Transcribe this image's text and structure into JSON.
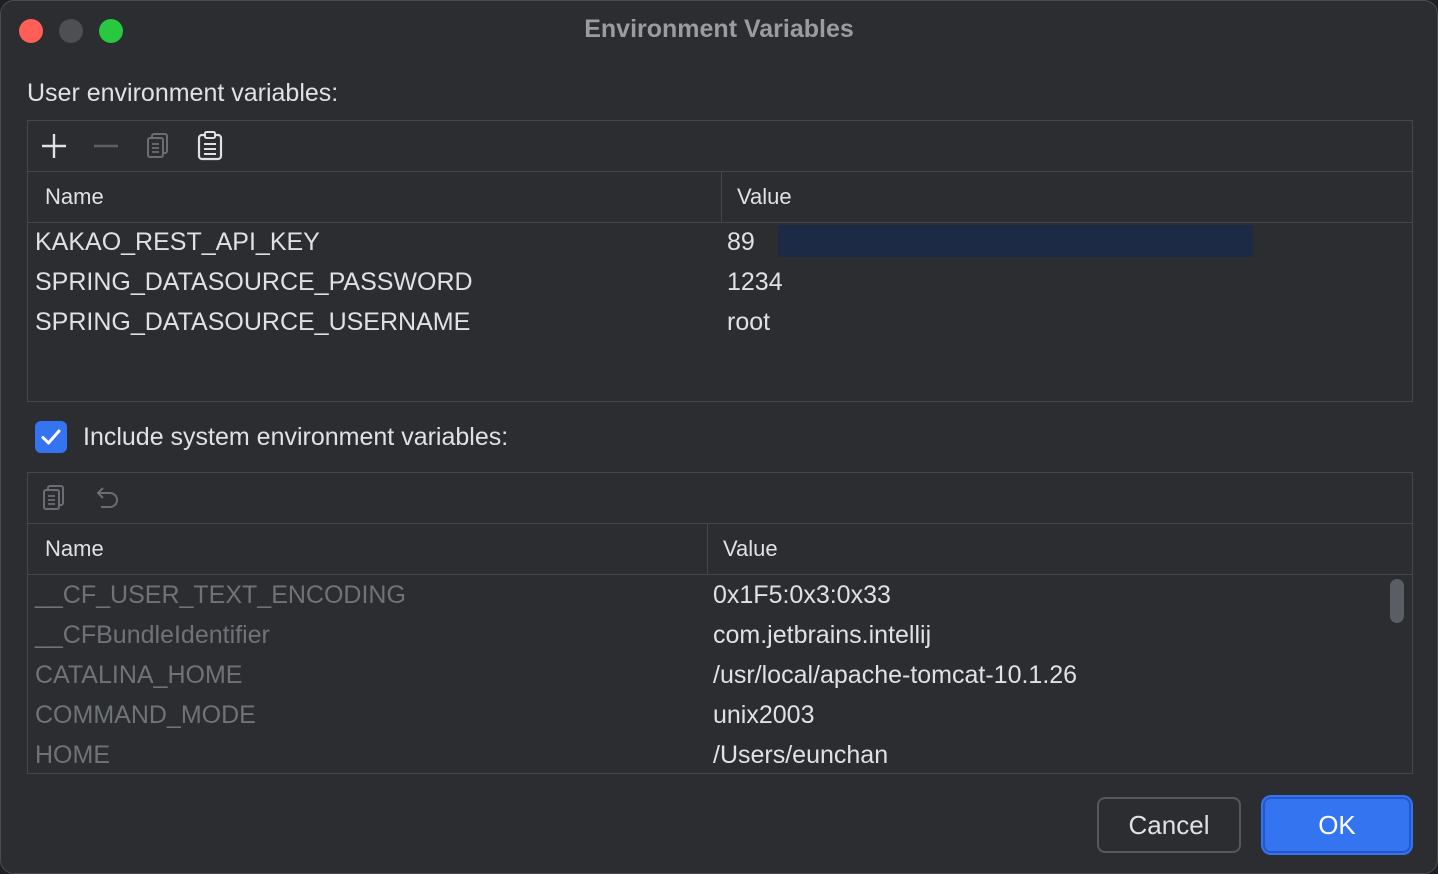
{
  "window": {
    "title": "Environment Variables"
  },
  "user_section": {
    "label": "User environment variables:",
    "columns": {
      "name": "Name",
      "value": "Value"
    },
    "rows": [
      {
        "name": "KAKAO_REST_API_KEY",
        "value": "89"
      },
      {
        "name": "SPRING_DATASOURCE_PASSWORD",
        "value": "1234"
      },
      {
        "name": "SPRING_DATASOURCE_USERNAME",
        "value": "root"
      }
    ]
  },
  "system_section": {
    "checkbox_label": "Include system environment variables:",
    "checked": true,
    "columns": {
      "name": "Name",
      "value": "Value"
    },
    "rows": [
      {
        "name": "__CF_USER_TEXT_ENCODING",
        "value": "0x1F5:0x3:0x33"
      },
      {
        "name": "__CFBundleIdentifier",
        "value": "com.jetbrains.intellij"
      },
      {
        "name": "CATALINA_HOME",
        "value": "/usr/local/apache-tomcat-10.1.26"
      },
      {
        "name": "COMMAND_MODE",
        "value": "unix2003"
      },
      {
        "name": "HOME",
        "value": "/Users/eunchan"
      }
    ]
  },
  "buttons": {
    "cancel": "Cancel",
    "ok": "OK"
  },
  "colors": {
    "accent": "#3574f0",
    "close": "#ff5f57",
    "maximize": "#28c840"
  },
  "icons": [
    "add-icon",
    "remove-icon",
    "copy-icon",
    "paste-icon",
    "undo-icon",
    "checkmark-icon"
  ]
}
